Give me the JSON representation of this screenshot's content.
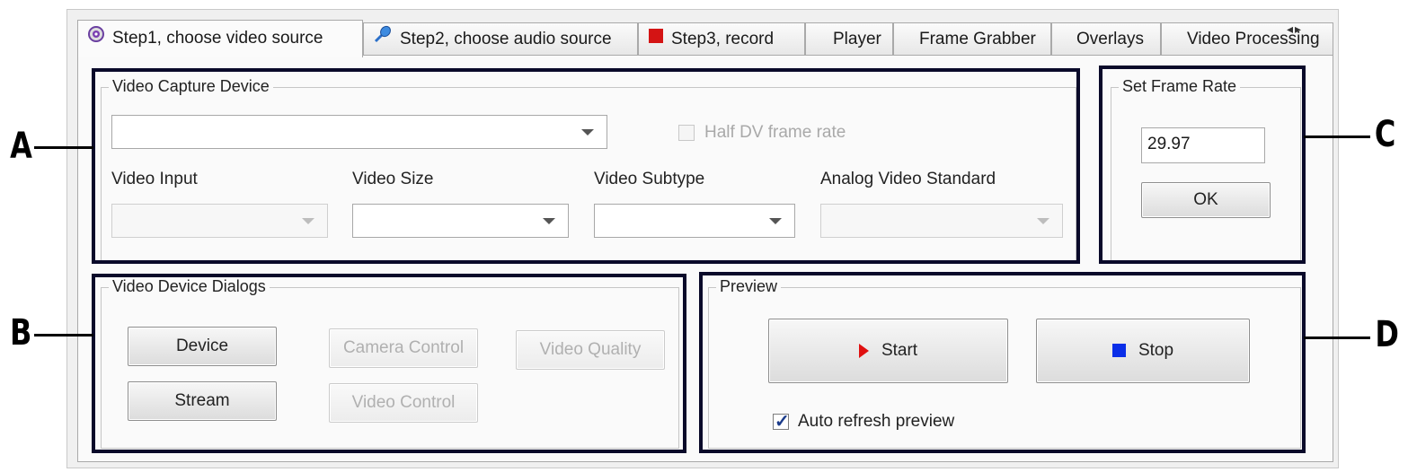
{
  "tabs": [
    {
      "label": "Step1, choose video source",
      "icon": "webcam-icon",
      "active": true
    },
    {
      "label": "Step2, choose audio source",
      "icon": "microphone-icon",
      "active": false
    },
    {
      "label": "Step3, record",
      "icon": "record-square-icon",
      "active": false
    },
    {
      "label": "Player",
      "active": false
    },
    {
      "label": "Frame Grabber",
      "active": false
    },
    {
      "label": "Overlays",
      "active": false
    },
    {
      "label": "Video Processing",
      "active": false
    }
  ],
  "video_capture_device": {
    "title": "Video Capture Device",
    "device_value": "",
    "half_dv_label": "Half DV frame rate",
    "half_dv_checked": false,
    "video_input_label": "Video Input",
    "video_input_value": "",
    "video_size_label": "Video Size",
    "video_size_value": "",
    "video_subtype_label": "Video Subtype",
    "video_subtype_value": "",
    "analog_standard_label": "Analog Video Standard",
    "analog_standard_value": ""
  },
  "frame_rate": {
    "title": "Set Frame Rate",
    "value": "29.97",
    "ok_label": "OK"
  },
  "device_dialogs": {
    "title": "Video Device Dialogs",
    "device_label": "Device",
    "stream_label": "Stream",
    "camera_control_label": "Camera Control",
    "video_control_label": "Video Control",
    "video_quality_label": "Video Quality"
  },
  "preview": {
    "title": "Preview",
    "start_label": "Start",
    "stop_label": "Stop",
    "auto_refresh_label": "Auto refresh preview",
    "auto_refresh_checked": true
  },
  "annotations": {
    "a": "A",
    "b": "B",
    "c": "C",
    "d": "D"
  },
  "colors": {
    "annotation_border": "#0a0a2a",
    "start_icon": "#e01010",
    "stop_icon": "#0a2ee8",
    "record_icon": "#d41414"
  }
}
